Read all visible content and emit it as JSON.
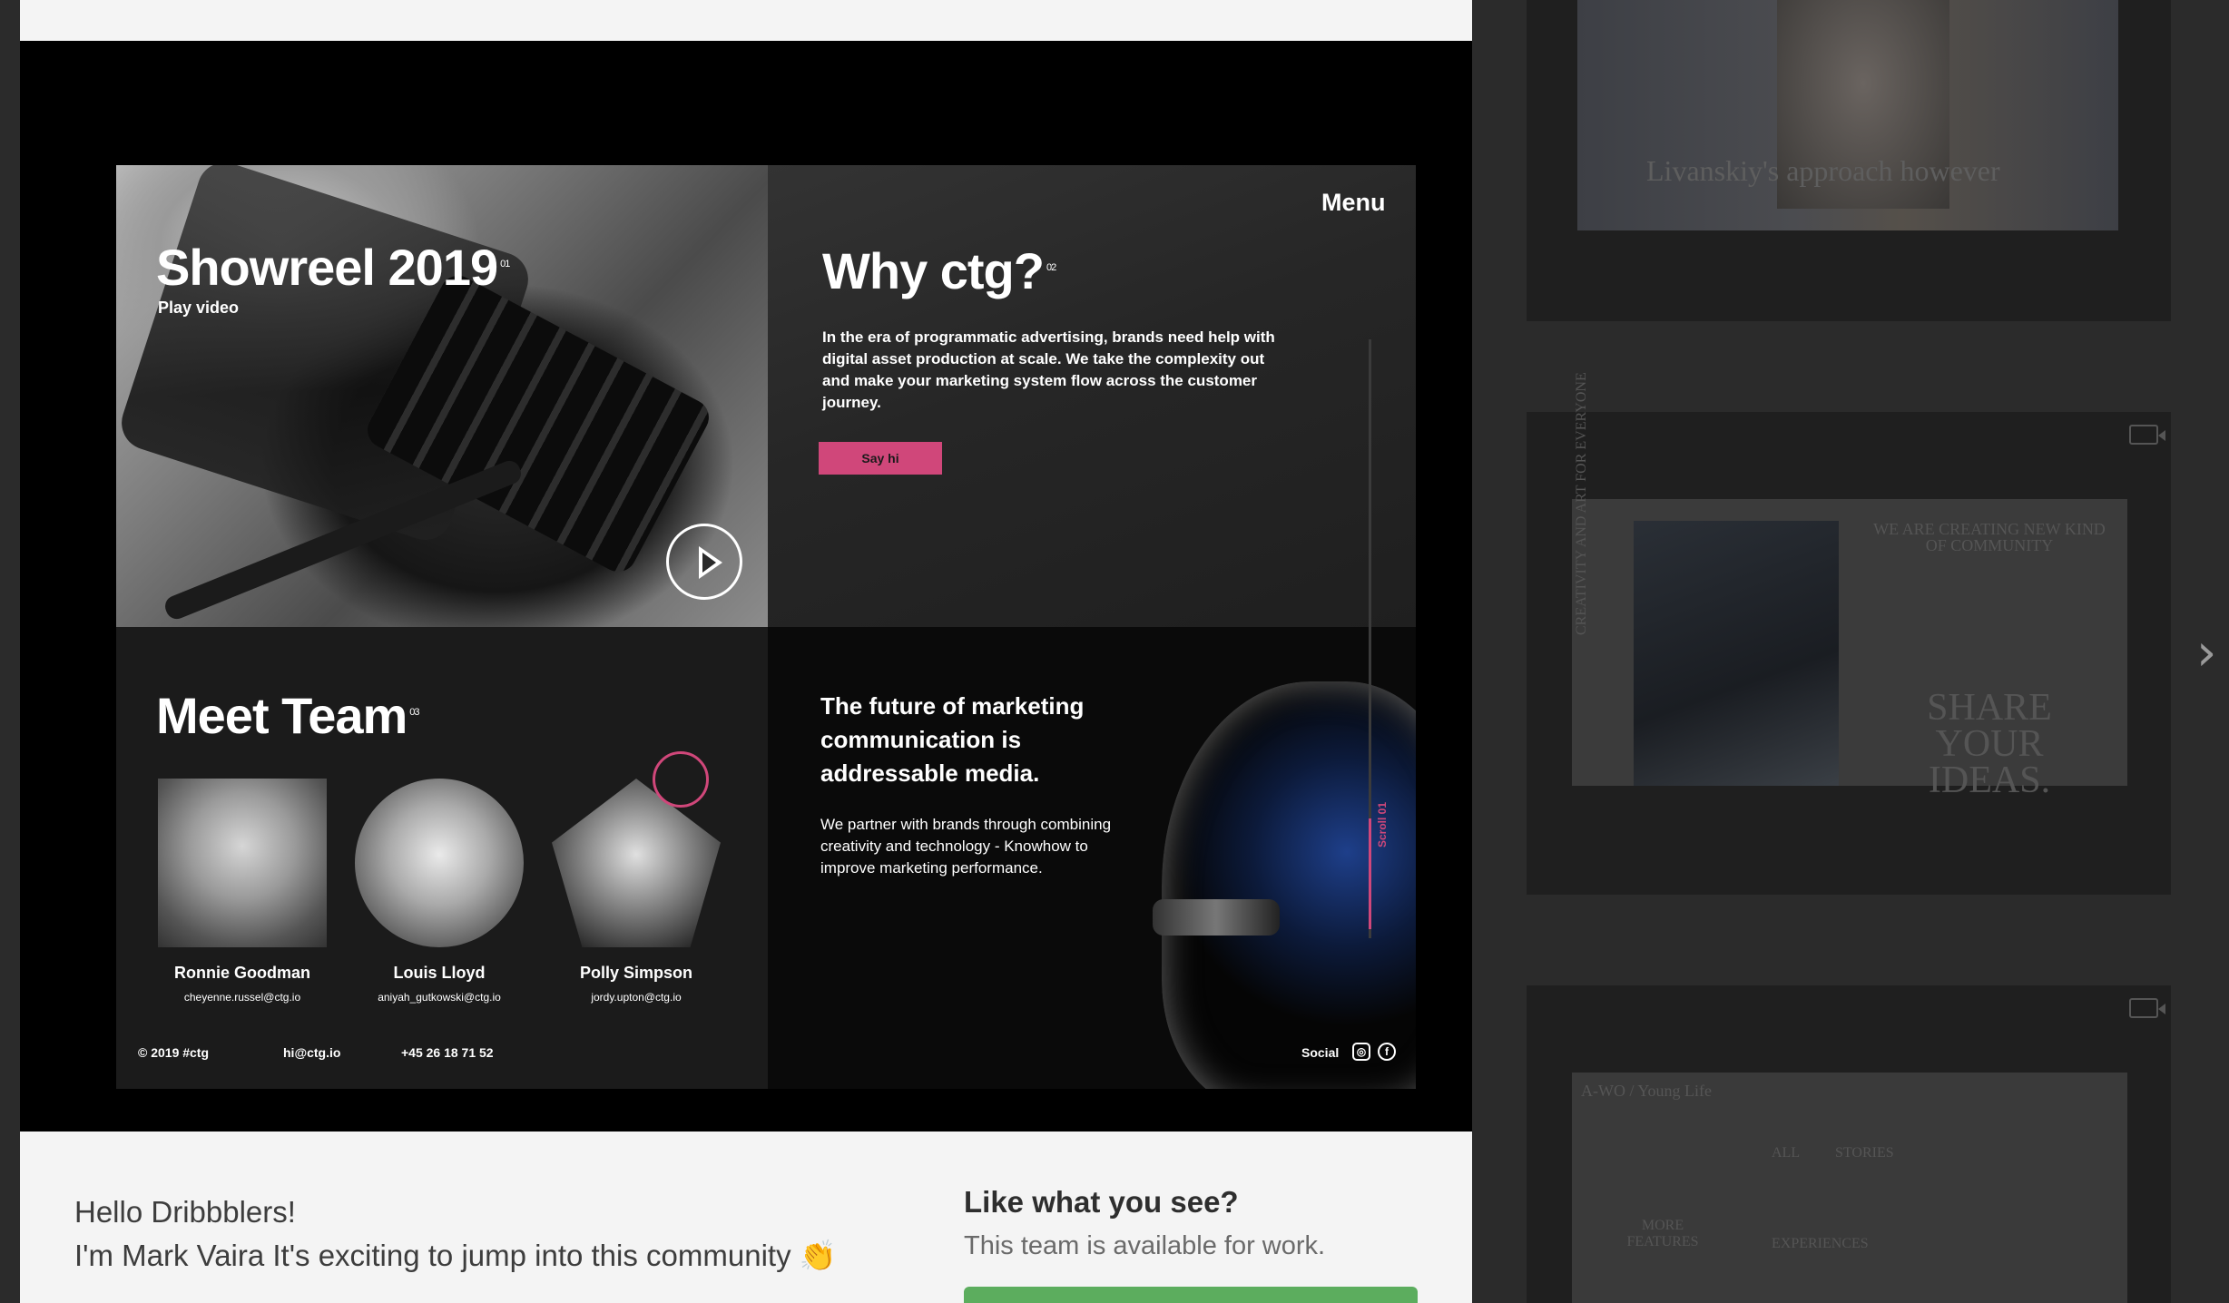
{
  "shot": {
    "menu": "Menu",
    "showreel": {
      "title": "Showreel 2019",
      "sup": "01",
      "play_label": "Play video"
    },
    "why": {
      "title": "Why ctg?",
      "sup": "02",
      "body": "In the era of programmatic advertising, brands need help with digital asset production at scale. We take the complexity out and make your marketing system flow across the customer journey.",
      "cta": "Say hi"
    },
    "team": {
      "title": "Meet Team",
      "sup": "03",
      "members": [
        {
          "name": "Ronnie Goodman",
          "email": "cheyenne.russel@ctg.io"
        },
        {
          "name": "Louis Lloyd",
          "email": "aniyah_gutkowski@ctg.io"
        },
        {
          "name": "Polly Simpson",
          "email": "jordy.upton@ctg.io"
        }
      ]
    },
    "future": {
      "title": "The future of marketing communication is addressable media.",
      "body": "We partner with brands through combining creativity and technology - Knowhow to improve marketing performance."
    },
    "scroll_label": "Scroll 01",
    "footer": {
      "copyright": "© 2019 #ctg",
      "email": "hi@ctg.io",
      "phone": "+45 26 18 71 52",
      "social_label": "Social"
    },
    "accent": "#d0477a"
  },
  "description": {
    "line1": "Hello Dribbblers!",
    "line2": "I'm Mark Vaira It's exciting to jump into this community 👏"
  },
  "hire": {
    "title": "Like what you see?",
    "subtitle": "This team is available for work.",
    "button_color": "#5cad5e"
  },
  "thumbs": {
    "t1_text": "Livanskiy's approach however",
    "t2": {
      "title": "WE ARE CREATING NEW KIND OF COMMUNITY",
      "big": "SHARE YOUR IDEAS.",
      "side": "CREATIVITY AND ART FOR EVERYONE"
    },
    "t3": {
      "label": "A-WO / Young Life",
      "cats": [
        "ALL",
        "STORIES",
        "EXPERIENCES"
      ],
      "more": "MORE FEATURES"
    }
  }
}
